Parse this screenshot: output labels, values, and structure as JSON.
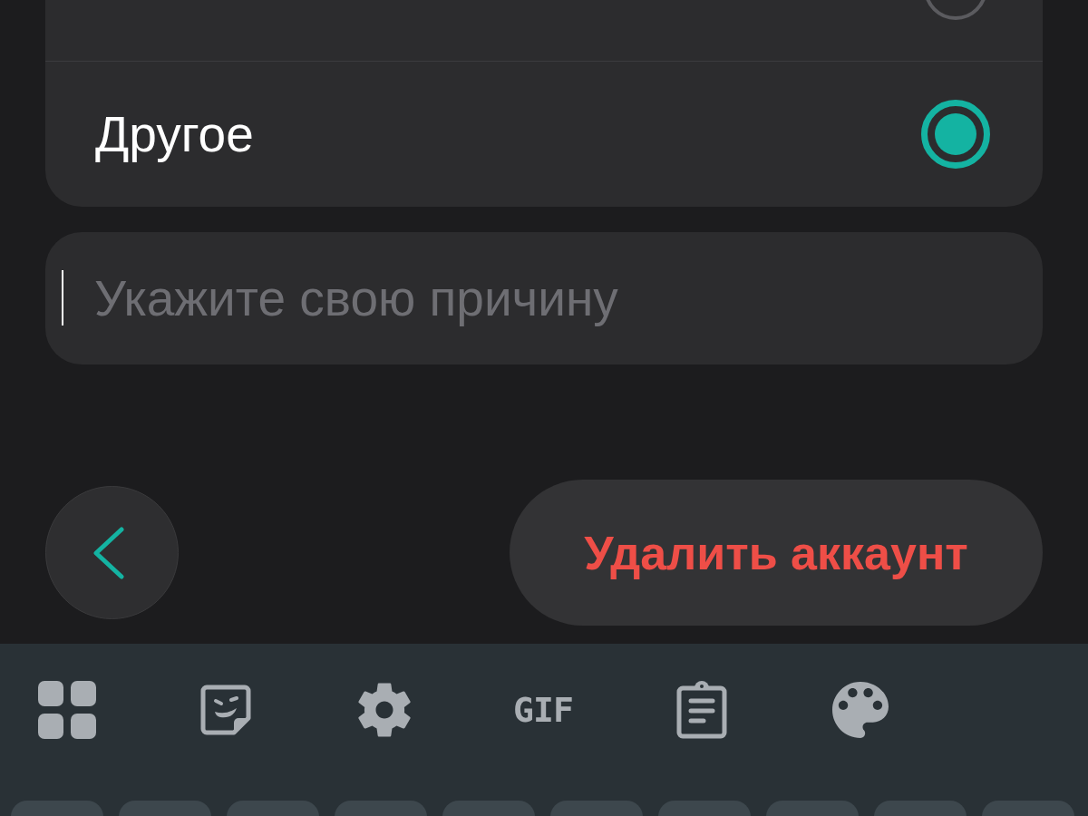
{
  "options": [
    {
      "selected": false
    },
    {
      "label": "Другое",
      "selected": true
    }
  ],
  "reason_field": {
    "placeholder": "Укажите свою причину"
  },
  "delete_button": {
    "label": "Удалить аккаунт"
  },
  "keyboard": {
    "toolbar_text": "GIF"
  }
}
